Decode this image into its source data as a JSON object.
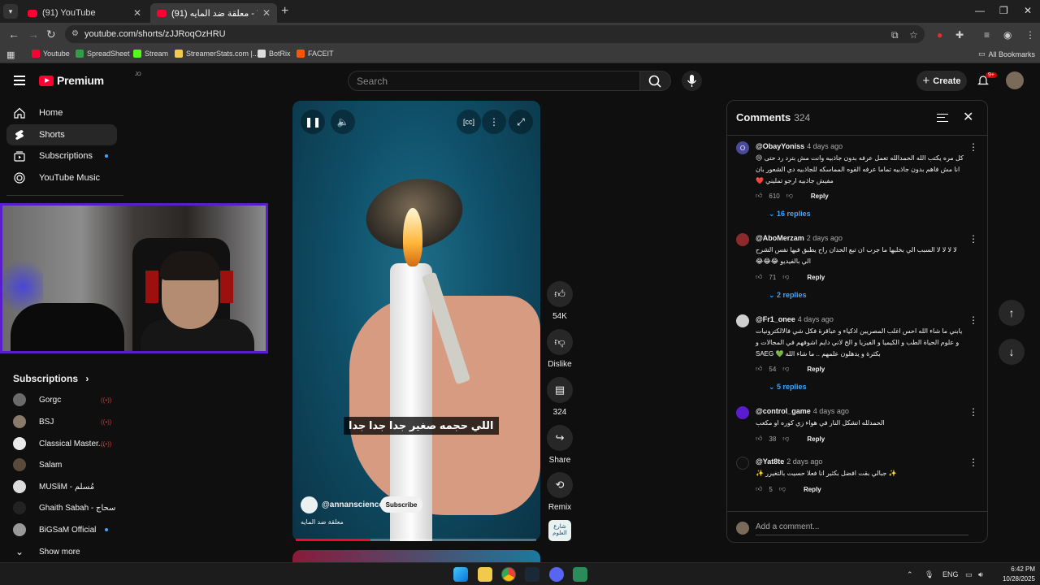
{
  "browser": {
    "tabs": [
      {
        "title": "(91) YouTube",
        "active": false
      },
      {
        "title": "(91) معلقة ضد المايه - YouTube",
        "active": true
      }
    ],
    "url": "youtube.com/shorts/zJJRoqOzHRU",
    "bookmarks": [
      {
        "label": "Youtube",
        "color": "#ff0033"
      },
      {
        "label": "SpreadSheet",
        "color": "#2f9e44"
      },
      {
        "label": "Stream",
        "color": "#53fc18"
      },
      {
        "label": "StreamerStats.com |...",
        "color": "#f2c94c"
      },
      {
        "label": "BotRix",
        "color": "#dddddd"
      },
      {
        "label": "FACEIT",
        "color": "#ff5500"
      }
    ],
    "all_bookmarks": "All Bookmarks"
  },
  "header": {
    "logo": "Premium",
    "region": "JO",
    "search_placeholder": "Search",
    "create_label": "Create",
    "notification_badge": "9+"
  },
  "sidebar": {
    "items": [
      {
        "label": "Home",
        "icon": "home-icon",
        "active": false
      },
      {
        "label": "Shorts",
        "icon": "shorts-icon",
        "active": true
      },
      {
        "label": "Subscriptions",
        "icon": "subscriptions-icon",
        "active": false
      },
      {
        "label": "YouTube Music",
        "icon": "music-icon",
        "active": false
      }
    ],
    "subscriptions_title": "Subscriptions",
    "subscriptions": [
      {
        "name": "Gorgc",
        "status": "live"
      },
      {
        "name": "BSJ",
        "status": "live"
      },
      {
        "name": "Classical Master...",
        "status": "live"
      },
      {
        "name": "Salam",
        "status": ""
      },
      {
        "name": "MUSliM - مُسلم",
        "status": ""
      },
      {
        "name": "Ghaith Sabah - سحاج",
        "status": ""
      },
      {
        "name": "BiGSaM Official",
        "status": "new"
      }
    ],
    "show_more": "Show more"
  },
  "short": {
    "caption": "اللي حجمه صغير جدا جدا جدا",
    "channel": "@annanscience",
    "subscribe_label": "Subscribe",
    "title": "معلقة ضد المايه",
    "progress": 0.31,
    "likes": "54K",
    "dislike_label": "Dislike",
    "comments_count": "324",
    "share_label": "Share",
    "remix_label": "Remix",
    "remix_thumb_text": "شارع العلوم"
  },
  "comments": {
    "title": "Comments",
    "count": "324",
    "reply_label": "Reply",
    "add_placeholder": "Add a comment...",
    "items": [
      {
        "author": "@ObayYoniss",
        "ago": "4 days ago",
        "avatar": "O",
        "avatar_color": "#5c5cc4",
        "text": "كل مره يكتب الله الحمدالله تعمل عرفه بدون جاذبيه وانت مش بترد رد حتى 😢 انا مش فاهم بدون جاذبيه تماما عرفه القوه المماسكه للجاذبيه دي الشعور بان مفيش جاذبيه ارجو تمليني ❤️",
        "likes": "610",
        "replies": "16 replies"
      },
      {
        "author": "@AboMerzam",
        "ago": "2 days ago",
        "avatar": "",
        "avatar_color": "#8a2a2a",
        "text": "لا لا لا لا السبب الي بخليها ما جرب ان تبع الحدان راح يطبق فيها نفس الشرح الي بالفيديو 😂😂😂",
        "likes": "71",
        "replies": "2 replies"
      },
      {
        "author": "@Fr1_onee",
        "ago": "4 days ago",
        "avatar": "",
        "avatar_color": "#cfcfcf",
        "text": "يابني ما شاء الله احس اغلب المصريين اذكياء و عباقرة فكل شي فالالكترونيات و علوم الحياة الطب و الكيميا و الفيزيا و الخ لاني دايم اشوفهم في المجالات و بكثرة و يدهلون علمهم .. ما شاء الله 💚 SAEG",
        "likes": "54",
        "replies": "5 replies"
      },
      {
        "author": "@control_game",
        "ago": "4 days ago",
        "avatar": "",
        "avatar_color": "#5a1ccc",
        "text": "الحمدلله اتشكل النار في هواء زي كوره او مكعب",
        "likes": "38",
        "replies": ""
      },
      {
        "author": "@Yat8te",
        "ago": "2 days ago",
        "avatar": "",
        "avatar_color": "#111111",
        "text": "✨ جبالي بقت افضل بكثير انا فعلا حسيت بالتغيرر ✨",
        "likes": "5",
        "replies": ""
      }
    ]
  },
  "taskbar": {
    "language": "ENG",
    "time": "6:42 PM",
    "date": "10/28/2025"
  }
}
